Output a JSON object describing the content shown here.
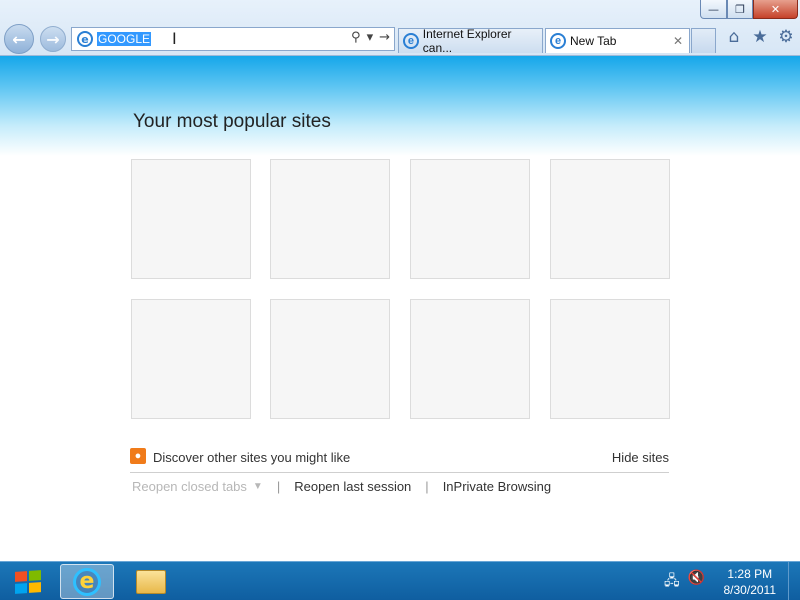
{
  "window": {
    "minimize_icon": "minimize-icon",
    "maximize_icon": "restore-icon",
    "close_icon": "close-icon"
  },
  "address_bar": {
    "value": "GOOGLE",
    "icons": [
      "search-icon",
      "dropdown-icon",
      "go-arrow-icon"
    ]
  },
  "tabs": [
    {
      "label": "Internet Explorer can...",
      "active": false
    },
    {
      "label": "New Tab",
      "active": true
    }
  ],
  "command_icons": [
    "home-icon",
    "favorites-star-icon",
    "tools-gear-icon"
  ],
  "page": {
    "title": "Your most popular sites",
    "tile_count": 8,
    "discover_label": "Discover other sites you might like",
    "hide_sites": "Hide sites",
    "reopen_closed_tabs": "Reopen closed tabs",
    "reopen_last_session": "Reopen last session",
    "inprivate": "InPrivate Browsing"
  },
  "taskbar": {
    "pinned": [
      "internet-explorer",
      "windows-explorer"
    ],
    "time": "1:28 PM",
    "date": "8/30/2011"
  },
  "colors": {
    "accent": "#15a7ea",
    "selection": "#3399ff",
    "taskbar": "#1c77b8"
  }
}
